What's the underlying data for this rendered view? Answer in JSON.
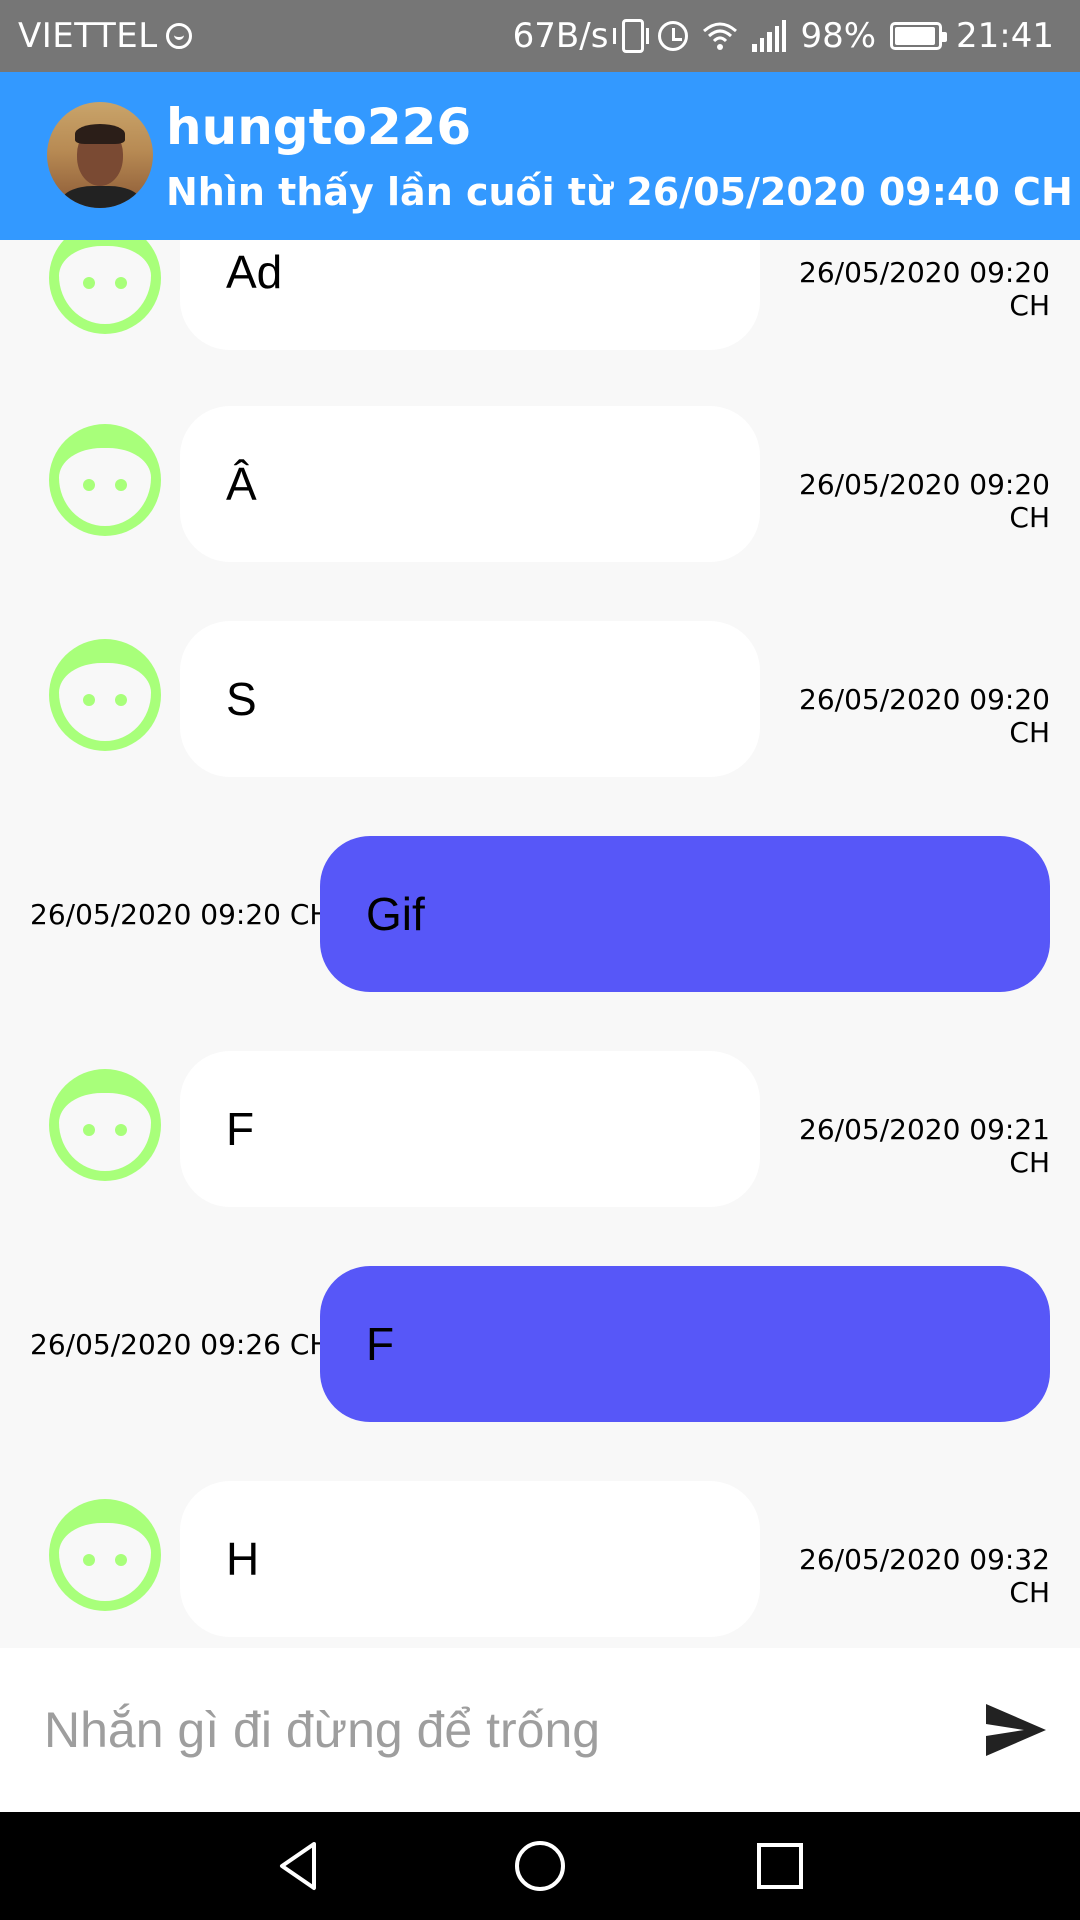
{
  "status_bar": {
    "carrier": "VIETTEL",
    "net_speed": "67B/s",
    "battery": "98%",
    "time": "21:41",
    "icons": [
      "vibrate-icon",
      "alarm-icon",
      "wifi-icon",
      "signal-icon",
      "battery-icon"
    ]
  },
  "header": {
    "name": "hungto226",
    "last_seen": "Nhìn thấy lần cuối từ 26/05/2020 09:40 CH",
    "avatar": "user-avatar"
  },
  "messages": [
    {
      "direction": "in",
      "text": "Ad",
      "time": "26/05/2020 09:20 CH"
    },
    {
      "direction": "in",
      "text": "Â",
      "time": "26/05/2020 09:20 CH"
    },
    {
      "direction": "in",
      "text": "S",
      "time": "26/05/2020 09:20 CH"
    },
    {
      "direction": "out",
      "text": "Gif",
      "time": "26/05/2020 09:20 CH"
    },
    {
      "direction": "in",
      "text": "F",
      "time": "26/05/2020 09:21 CH"
    },
    {
      "direction": "out",
      "text": "F",
      "time": "26/05/2020 09:26 CH"
    },
    {
      "direction": "in",
      "text": "H",
      "time": "26/05/2020 09:32 CH"
    }
  ],
  "composer": {
    "placeholder": "Nhắn gì đi đừng để trống",
    "value": "",
    "send_icon": "send-icon"
  },
  "colors": {
    "status_bar": "#767676",
    "header": "#3399ff",
    "incoming_bubble": "#ffffff",
    "outgoing_bubble": "#5757f8",
    "avatar_smiley": "#a8ff7a",
    "nav_bar": "#000000"
  },
  "nav_bar": {
    "icons": [
      "back-icon",
      "home-icon",
      "recents-icon"
    ]
  }
}
